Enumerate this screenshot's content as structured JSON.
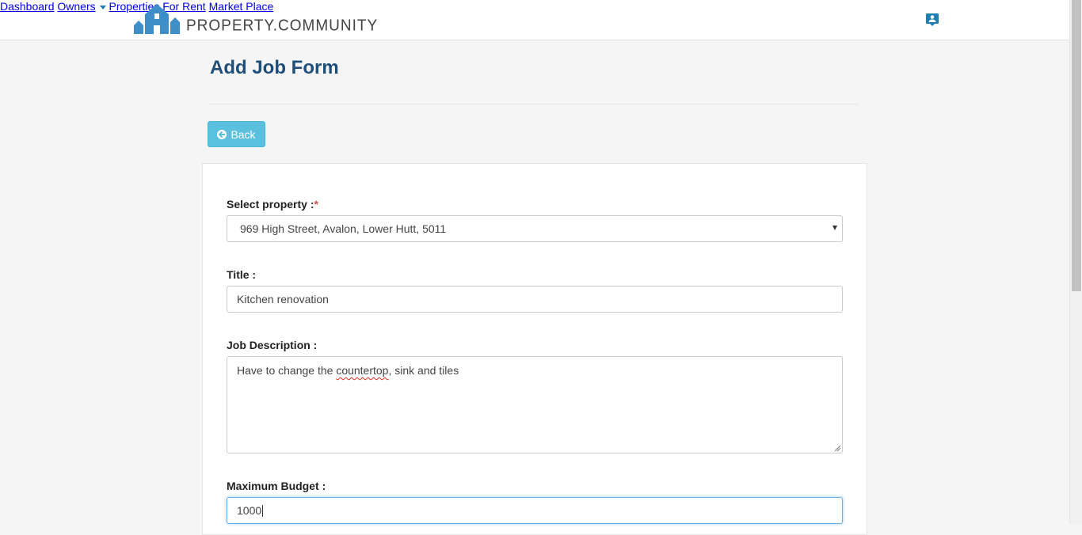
{
  "brand": {
    "name": "PROPERTY.COMMUNITY",
    "color": "#3d8ec9"
  },
  "nav": {
    "dashboard": "Dashboard",
    "owners": "Owners",
    "properties_for_rent": "Properties For Rent",
    "market_place": "Market Place",
    "account_icon": "user-card-icon"
  },
  "page": {
    "title": "Add Job Form"
  },
  "back_button": {
    "label": "Back",
    "icon": "arrow-left-icon"
  },
  "form": {
    "property": {
      "label": "Select property :",
      "required_mark": "*",
      "value": "969 High Street, Avalon, Lower Hutt, 5011"
    },
    "title": {
      "label": "Title :",
      "value": "Kitchen renovation"
    },
    "description": {
      "label": "Job Description :",
      "value_before": "Have to change the ",
      "value_misspelled": "countertop",
      "value_after": ", sink and tiles"
    },
    "budget": {
      "label": "Maximum Budget :",
      "value": "1000"
    }
  },
  "colors": {
    "nav_link": "#1e7fb3",
    "title": "#1f4e79",
    "button": "#5bc0de",
    "required": "#d9534f"
  }
}
